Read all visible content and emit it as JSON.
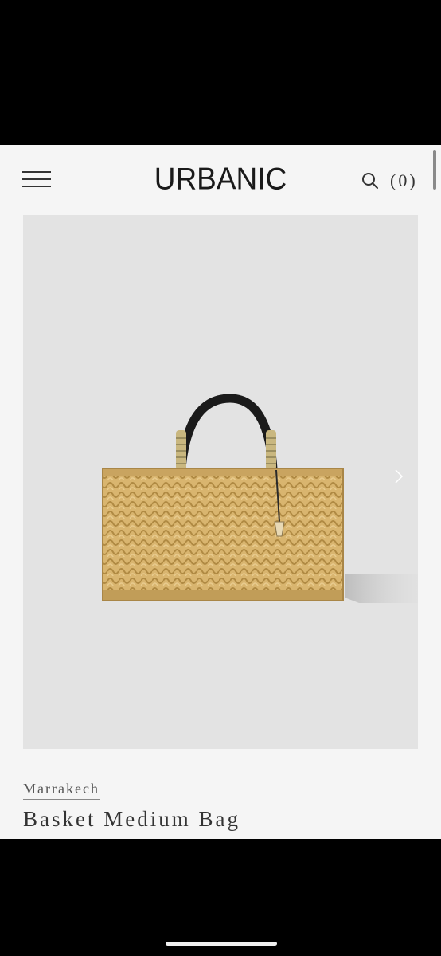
{
  "header": {
    "brand": "URBANIC",
    "cart_label": "(0)"
  },
  "icons": {
    "menu": "hamburger-menu-icon",
    "search": "search-icon",
    "next": "chevron-right-icon"
  },
  "product": {
    "designer": "Marrakech",
    "name": "Basket Medium Bag"
  },
  "colors": {
    "screen_background": "#f5f5f5",
    "image_background": "#e3e3e3",
    "text": "#333333"
  }
}
